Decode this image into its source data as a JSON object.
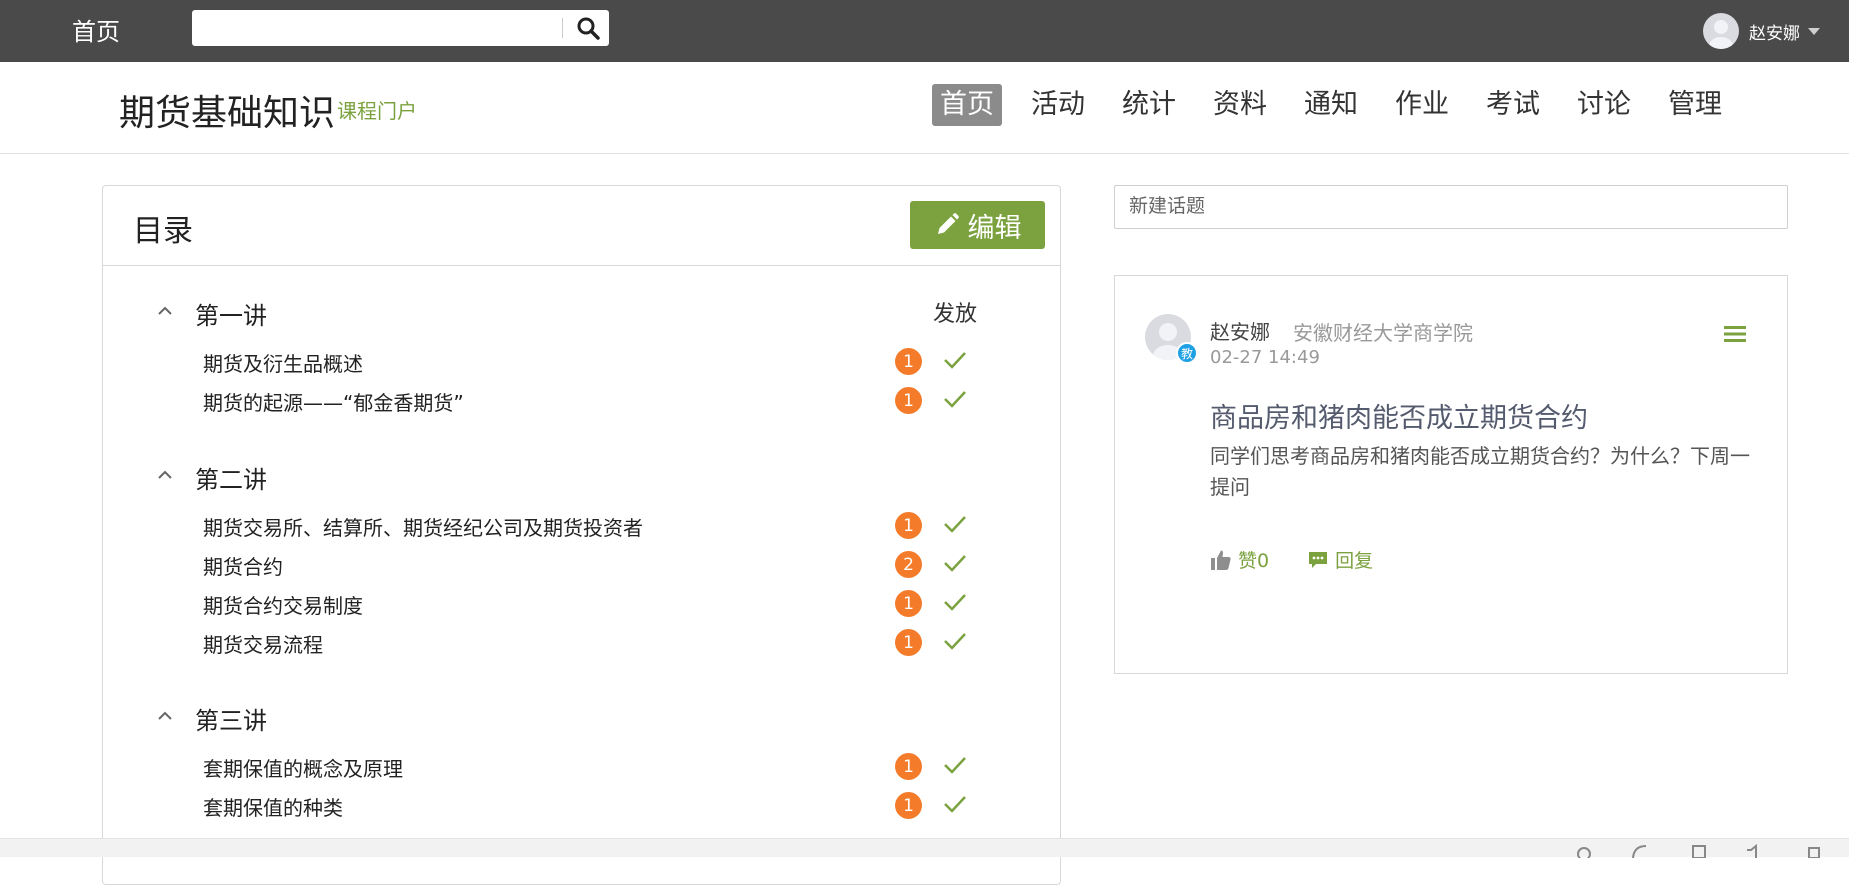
{
  "topbar": {
    "home_label": "首页",
    "search": {
      "value": "",
      "placeholder": ""
    },
    "user_name": "赵安娜"
  },
  "course": {
    "title": "期货基础知识",
    "subtitle": "课程门户",
    "nav": [
      {
        "label": "首页",
        "active": true
      },
      {
        "label": "活动"
      },
      {
        "label": "统计"
      },
      {
        "label": "资料"
      },
      {
        "label": "通知"
      },
      {
        "label": "作业"
      },
      {
        "label": "考试"
      },
      {
        "label": "讨论"
      },
      {
        "label": "管理"
      }
    ]
  },
  "directory": {
    "title": "目录",
    "edit_label": "编辑",
    "release_label": "发放",
    "chapters": [
      {
        "name": "第一讲",
        "lessons": [
          {
            "name": "期货及衍生品概述",
            "count": "1"
          },
          {
            "name": "期货的起源——“郁金香期货”",
            "count": "1"
          }
        ]
      },
      {
        "name": "第二讲",
        "lessons": [
          {
            "name": "期货交易所、结算所、期货经纪公司及期货投资者",
            "count": "1"
          },
          {
            "name": "期货合约",
            "count": "2"
          },
          {
            "name": "期货合约交易制度",
            "count": "1"
          },
          {
            "name": "期货交易流程",
            "count": "1"
          }
        ]
      },
      {
        "name": "第三讲",
        "lessons": [
          {
            "name": "套期保值的概念及原理",
            "count": "1"
          },
          {
            "name": "套期保值的种类",
            "count": "1"
          }
        ]
      }
    ]
  },
  "discussion": {
    "new_topic_placeholder": "新建话题",
    "post": {
      "author": "赵安娜",
      "school": "安徽财经大学商学院",
      "time": "02-27 14:49",
      "teacher_badge": "教",
      "title": "商品房和猪肉能否成立期货合约",
      "body": "同学们思考商品房和猪肉能否成立期货合约？为什么？下周一提问",
      "like_label": "赞0",
      "reply_label": "回复"
    }
  },
  "colors": {
    "accent_green": "#7ba23f",
    "badge_orange": "#f47b2a",
    "topbar_bg": "#4a4a4a",
    "teacher_blue": "#1ea0e5"
  }
}
